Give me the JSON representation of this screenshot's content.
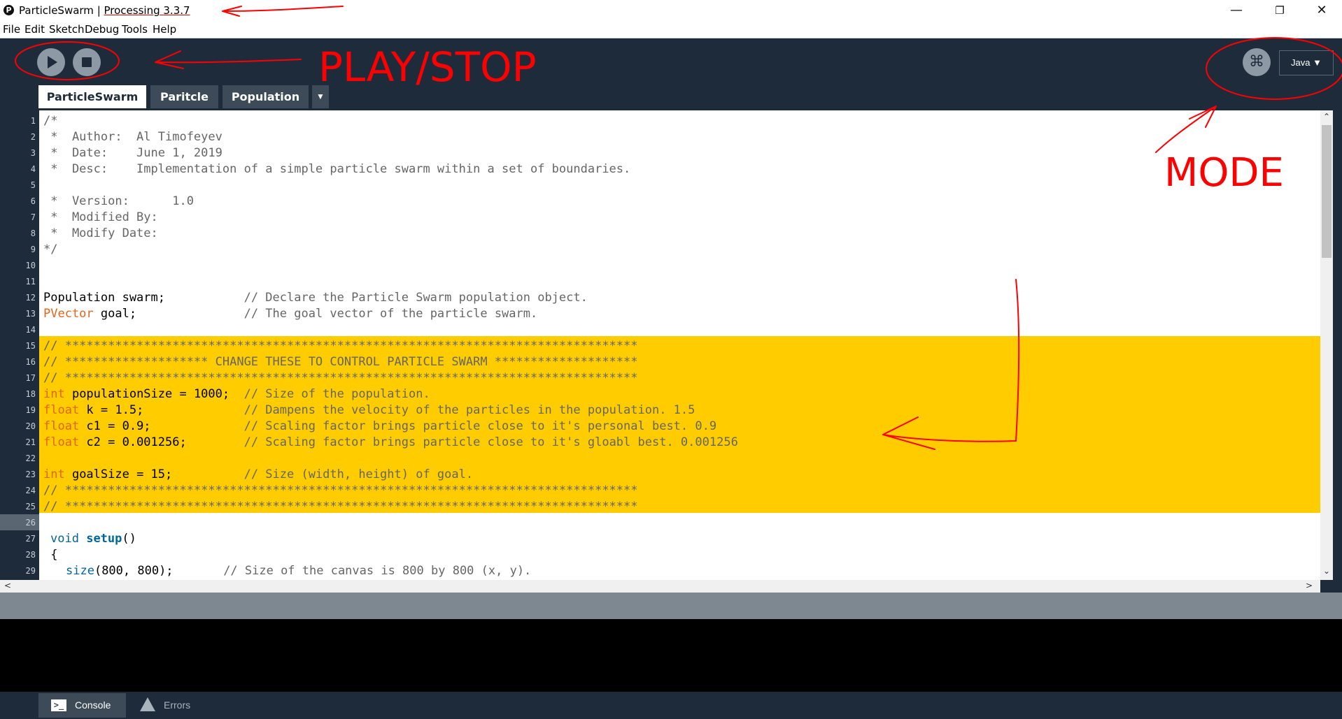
{
  "window": {
    "title_sketch": "ParticleSwarm",
    "title_separator": " | ",
    "title_app": "Processing 3.3.7",
    "app_logo": "P",
    "controls": {
      "minimize": "—",
      "maximize": "❐",
      "close": "✕"
    }
  },
  "menu": [
    "File",
    "Edit",
    "Sketch",
    "Debug",
    "Tools",
    "Help"
  ],
  "toolbar": {
    "play_icon": "play-icon",
    "stop_icon": "stop-icon",
    "mode_icon_glyph": "⌘",
    "mode_label": "Java ▼"
  },
  "tabs": [
    "ParticleSwarm",
    "Paritcle",
    "Population"
  ],
  "tab_menu": "▼",
  "editor": {
    "line_numbers": [
      "1",
      "2",
      "3",
      "4",
      "5",
      "6",
      "7",
      "8",
      "9",
      "10",
      "11",
      "12",
      "13",
      "14",
      "15",
      "16",
      "17",
      "18",
      "19",
      "20",
      "21",
      "22",
      "23",
      "24",
      "25",
      "26",
      "27",
      "28",
      "29"
    ],
    "code": {
      "l1": "/*",
      "l2": " *  Author:  Al Timofeyev",
      "l3": " *  Date:    June 1, 2019",
      "l4": " *  Desc:    Implementation of a simple particle swarm within a set of boundaries.",
      "l6": " *  Version:      1.0",
      "l7": " *  Modified By:",
      "l8": " *  Modify Date:",
      "l9": "*/",
      "l12_code": "Population swarm;           ",
      "l12_comment": "// Declare the Particle Swarm population object.",
      "l13_kw": "PVector",
      "l13_code": " goal;               ",
      "l13_comment": "// The goal vector of the particle swarm.",
      "l15": "// ********************************************************************************",
      "l16": "// ******************** CHANGE THESE TO CONTROL PARTICLE SWARM ********************",
      "l17": "// ********************************************************************************",
      "l18_kw": "int",
      "l18_code": " populationSize = 1000;  ",
      "l18_comment": "// Size of the population.",
      "l19_kw": "float",
      "l19_code": " k = 1.5;              ",
      "l19_comment": "// Dampens the velocity of the particles in the population. 1.5",
      "l20_kw": "float",
      "l20_code": " c1 = 0.9;             ",
      "l20_comment": "// Scaling factor brings particle close to it's personal best. 0.9",
      "l21_kw": "float",
      "l21_code": " c2 = 0.001256;        ",
      "l21_comment": "// Scaling factor brings particle close to it's gloabl best. 0.001256",
      "l23_kw": "int",
      "l23_code": " goalSize = 15;          ",
      "l23_comment": "// Size (width, height) of goal.",
      "l24": "// ********************************************************************************",
      "l25": "// ********************************************************************************",
      "l27_kw": "void",
      "l27_fn": "setup",
      "l27_rest": "()",
      "l28": " {",
      "l29_fn": "size",
      "l29_code": "(800, 800);       ",
      "l29_comment": "// Size of the canvas is 800 by 800 (x, y)."
    }
  },
  "scroll": {
    "up": "⌃",
    "down": "⌄",
    "left": "<",
    "right": ">"
  },
  "footer": {
    "console_label": "Console",
    "console_icon_glyph": ">_",
    "errors_label": "Errors"
  },
  "annotations": {
    "play_stop": "PLAY/STOP",
    "mode": "MODE",
    "color": "#ff0000"
  }
}
